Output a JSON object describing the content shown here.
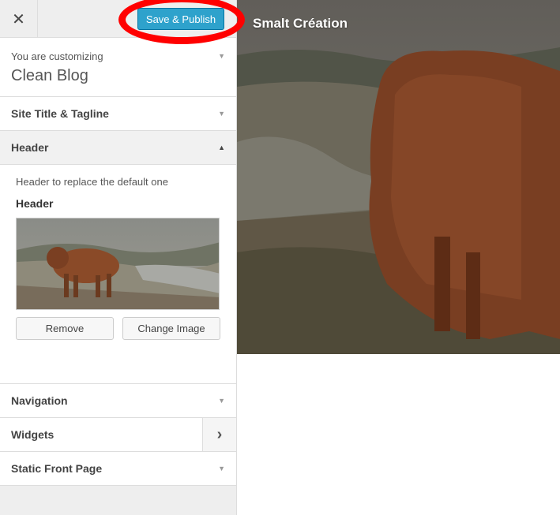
{
  "topbar": {
    "close_icon": "close-icon",
    "close_glyph": "✕",
    "save_label": "Save & Publish",
    "save_color": "#2ea2cc"
  },
  "customizing": {
    "prefix": "You are customizing",
    "theme": "Clean Blog"
  },
  "sections": {
    "site_title": "Site Title & Tagline",
    "header": "Header",
    "navigation": "Navigation",
    "widgets": "Widgets",
    "static_front": "Static Front Page"
  },
  "header_panel": {
    "description": "Header to replace the default one",
    "subtitle": "Header",
    "remove_label": "Remove",
    "change_label": "Change Image"
  },
  "preview": {
    "site_title": "Smalt Création"
  }
}
